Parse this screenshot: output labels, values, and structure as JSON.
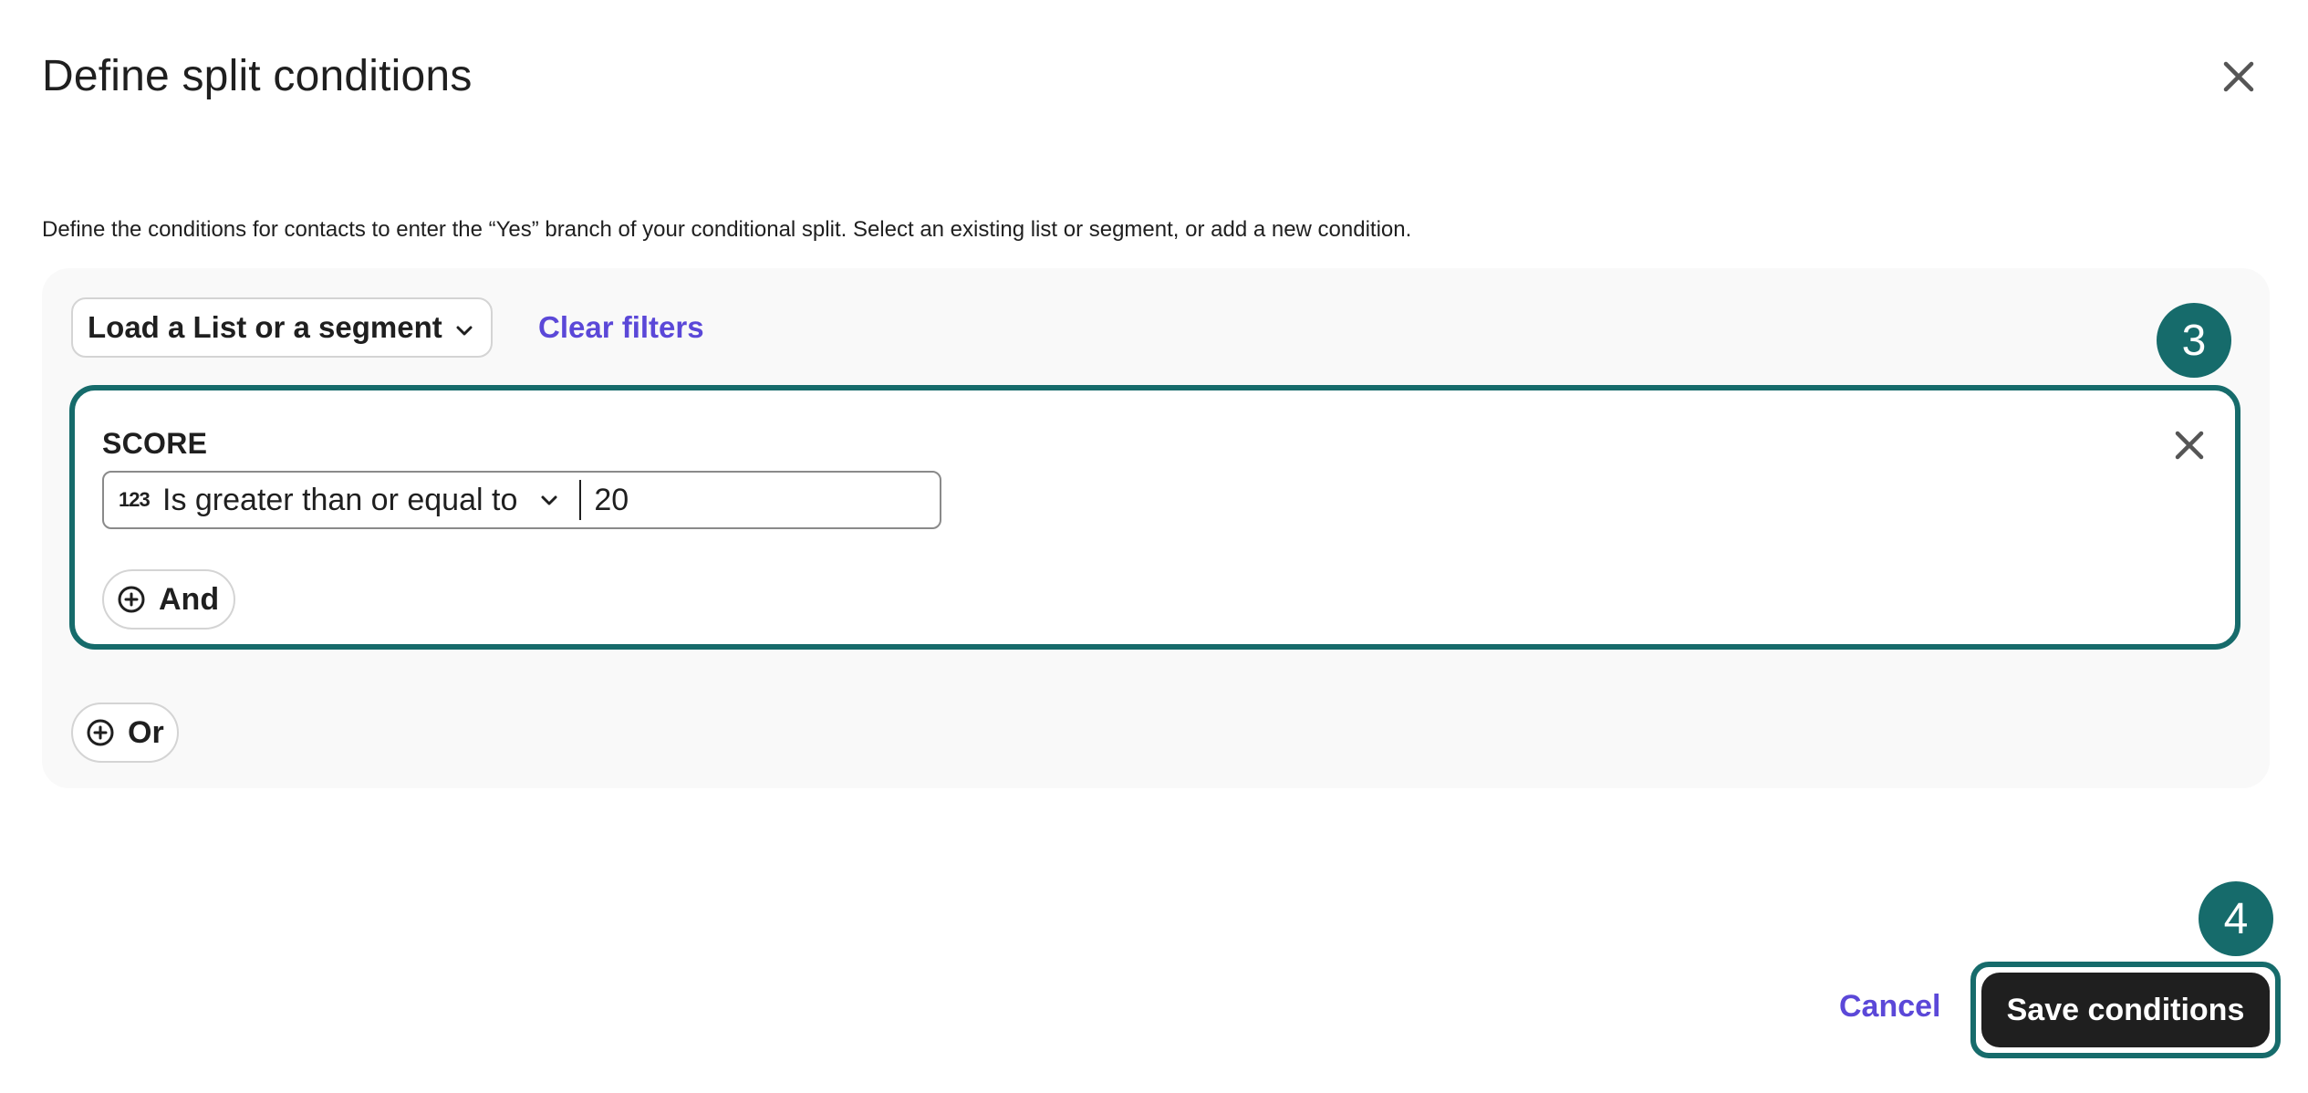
{
  "header": {
    "title": "Define split conditions"
  },
  "description": "Define the conditions for contacts to enter the “Yes” branch of your conditional split. Select an existing list or segment, or add a new condition.",
  "filters": {
    "load_label": "Load a List or a segment",
    "clear_label": "Clear filters"
  },
  "condition": {
    "field": "SCORE",
    "type_icon_text": "123",
    "operator": "Is greater than or equal to",
    "value": "20",
    "and_label": "And"
  },
  "or_label": "Or",
  "badges": {
    "step3": "3",
    "step4": "4"
  },
  "footer": {
    "cancel_label": "Cancel",
    "save_label": "Save conditions"
  },
  "colors": {
    "accent_link": "#5b48d8",
    "highlight_teal": "#166b6b",
    "primary_button": "#1f1f1f",
    "panel_bg": "#f9f9f9"
  },
  "icons": {
    "close": "close-icon",
    "chevron": "chevron-down-icon",
    "plus_circle": "plus-circle-icon",
    "number_type": "number-type-icon"
  }
}
